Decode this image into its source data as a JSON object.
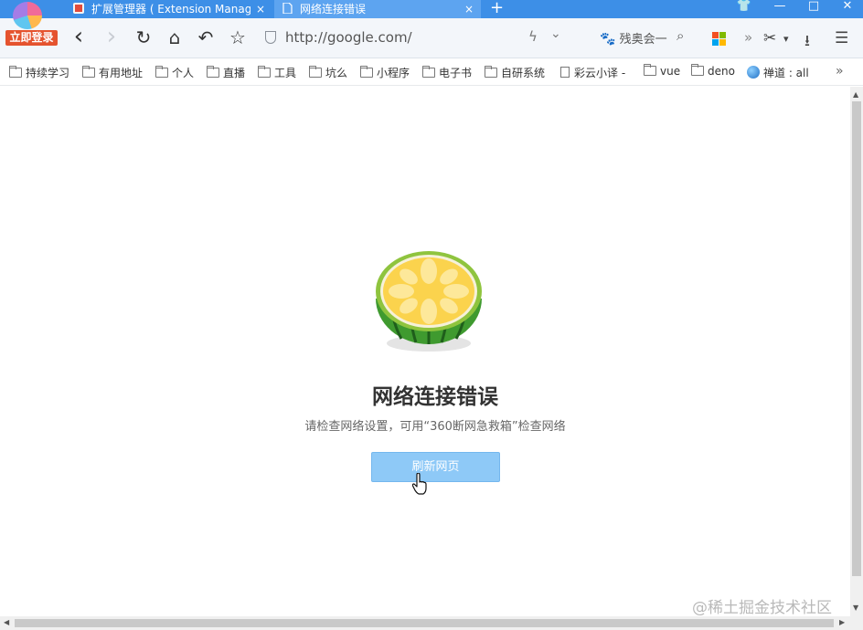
{
  "browser": {
    "login_button": "立即登录",
    "tabs": [
      {
        "title": "扩展管理器 ( Extension Manag",
        "close": "×",
        "active": false
      },
      {
        "title": "网络连接错误",
        "close": "×",
        "active": true
      }
    ],
    "new_tab": "+",
    "window_controls": {
      "skin": "👕",
      "minimize": "—",
      "maximize": "□",
      "close": "✕"
    }
  },
  "toolbar": {
    "back": "‹",
    "forward": "›",
    "refresh": "↻",
    "home": "⌂",
    "undo": "↶",
    "favorite": "☆",
    "url": "http://google.com/",
    "speed_icon": "ϟ",
    "dropdown_icon": "⌄",
    "search_text": "残奥会一",
    "search_icon": "🔍",
    "more": "»",
    "cut": "✂",
    "cut_dropdown": "▾",
    "download": "⭳",
    "menu": "☰"
  },
  "bookmarks": {
    "items": [
      {
        "label": "持续学习",
        "icon": "folder"
      },
      {
        "label": "有用地址",
        "icon": "folder"
      },
      {
        "label": "个人",
        "icon": "folder"
      },
      {
        "label": "直播",
        "icon": "folder"
      },
      {
        "label": "工具",
        "icon": "folder"
      },
      {
        "label": "坑么",
        "icon": "folder"
      },
      {
        "label": "小程序",
        "icon": "folder"
      },
      {
        "label": "电子书",
        "icon": "folder"
      },
      {
        "label": "自研系统",
        "icon": "folder"
      },
      {
        "label": "彩云小译 -",
        "icon": "page"
      },
      {
        "label": "vue",
        "icon": "folder"
      },
      {
        "label": "deno",
        "icon": "folder"
      },
      {
        "label": "禅道 : all",
        "icon": "globe"
      }
    ],
    "overflow": "»"
  },
  "error_page": {
    "title": "网络连接错误",
    "description": "请检查网络设置，可用“360断网急救箱”检查网络",
    "refresh_button": "刷新网页",
    "watermark": "@稀土掘金技术社区"
  },
  "colors": {
    "tab_bar": "#3d8fe7",
    "active_tab": "#5da4f0",
    "refresh_button": "#8ec9f7",
    "login_badge": "#e5532e"
  }
}
